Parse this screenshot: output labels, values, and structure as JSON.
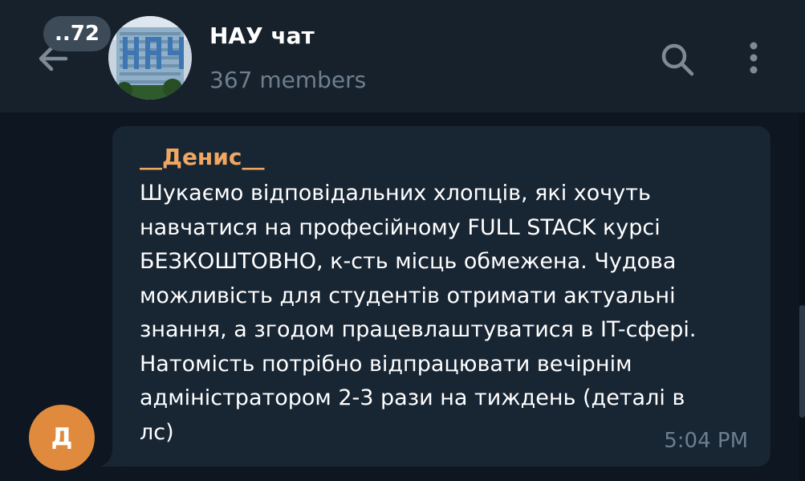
{
  "header": {
    "unread_count": "..72",
    "chat_title": "НАУ чат",
    "chat_subtitle": "367 members",
    "back_icon": "arrow-left-icon",
    "search_icon": "search-icon",
    "menu_icon": "more-vertical-icon"
  },
  "message": {
    "sender_initial": "Д",
    "sender_name": "__Денис__",
    "text": "Шукаємо відповідальних хлопців, які хочуть\nнавчатися на професійному FULL STACK курсі\nБЕЗКОШТОВНО, к-сть місць обмежена. Чудова\nможливість для студентів  отримати актуальні\nзнання, а згодом працевлаштуватися в IT-сфері.\nНатомість потрібно відпрацювати вечірнім\nадміністратором 2-3 рази на тиждень (деталі в\nлс)",
    "time": "5:04 PM"
  },
  "colors": {
    "background": "#0e1621",
    "header": "#17212b",
    "bubble": "#182533",
    "sender_name": "#f0a762",
    "avatar": "#e08a3e",
    "muted_text": "#6d7f8f"
  }
}
